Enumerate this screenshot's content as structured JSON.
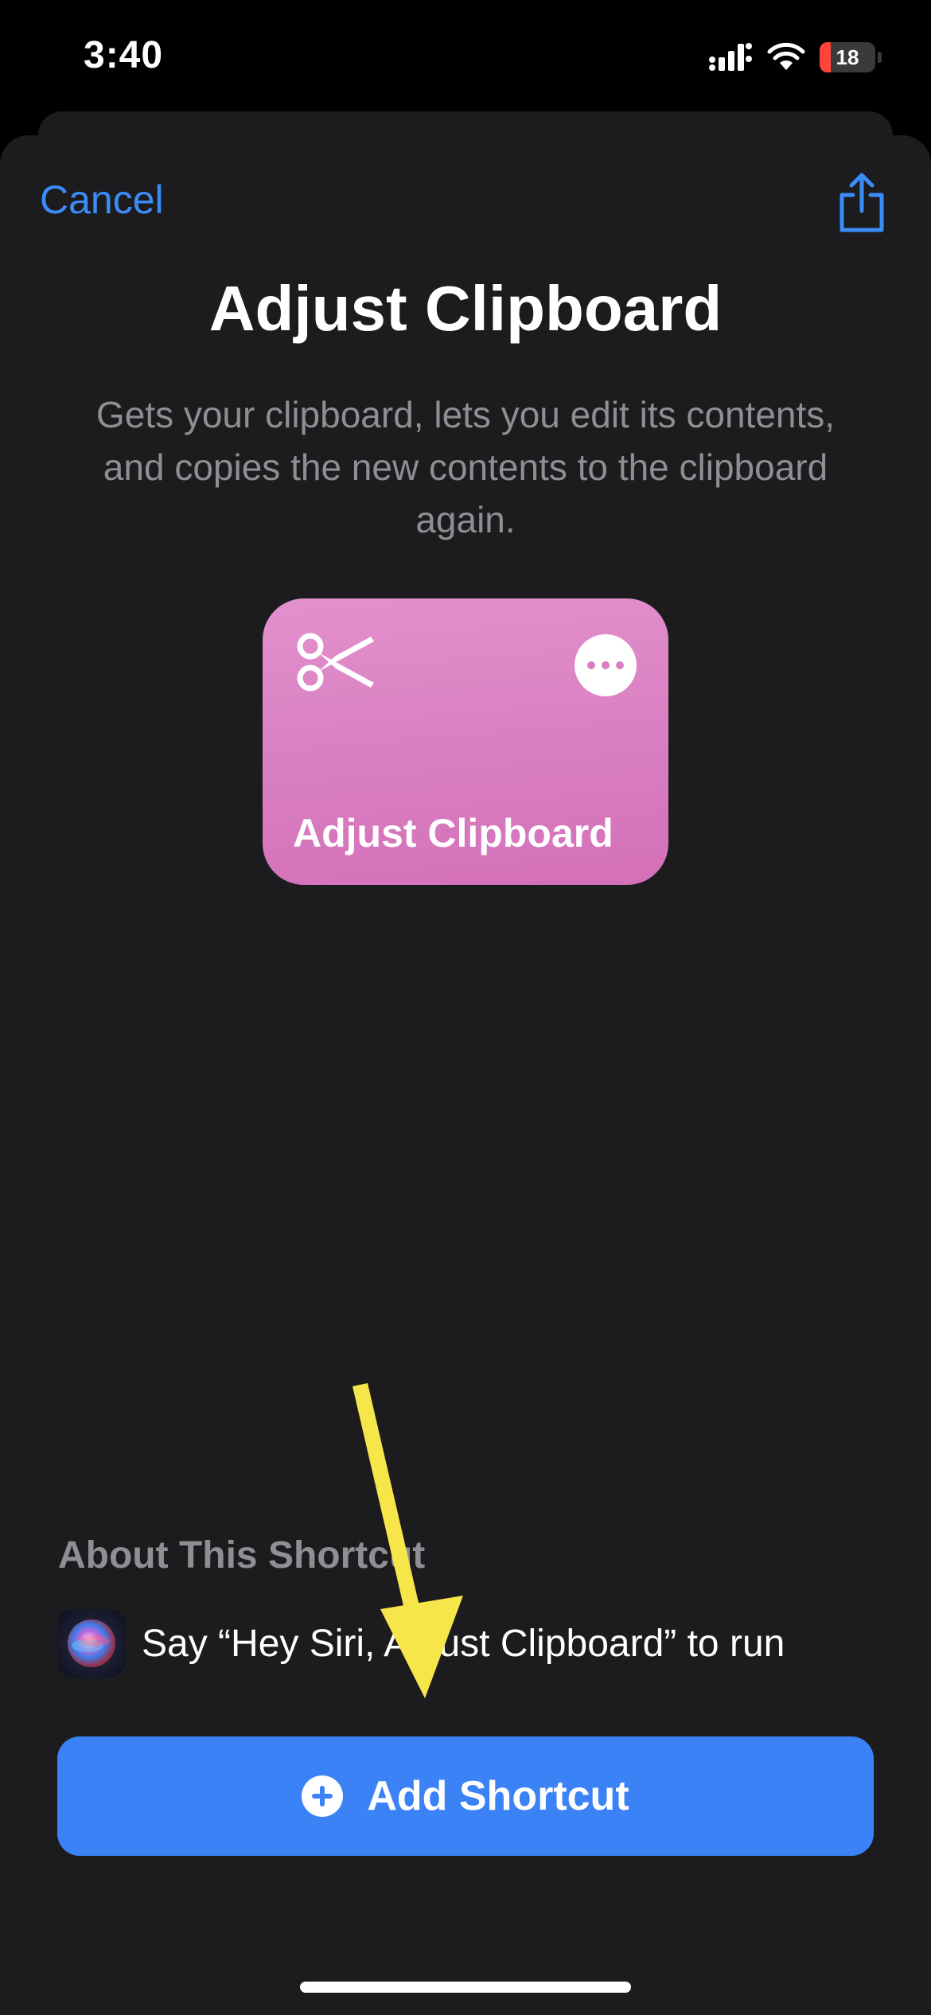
{
  "status_bar": {
    "time": "3:40",
    "battery_level": "18",
    "icons": [
      "signal-icon",
      "wifi-icon",
      "battery-icon"
    ]
  },
  "header": {
    "cancel_label": "Cancel",
    "share_icon": "share-icon"
  },
  "shortcut": {
    "title": "Adjust Clipboard",
    "description": "Gets your clipboard, lets you edit its contents, and copies the new contents to the clipboard again.",
    "card_label": "Adjust Clipboard",
    "card_icon": "scissors-icon",
    "more_icon": "ellipsis-icon"
  },
  "about": {
    "heading": "About This Shortcut",
    "siri_text": "Say “Hey Siri, Adjust Clipboard” to run"
  },
  "add_button": {
    "label": "Add Shortcut",
    "icon": "plus-circle-icon"
  },
  "colors": {
    "accent": "#3b8cf7",
    "button": "#3a82f6",
    "sheet": "#1c1c1e",
    "card": "#dc85c5",
    "arrow": "#f7e64a"
  }
}
